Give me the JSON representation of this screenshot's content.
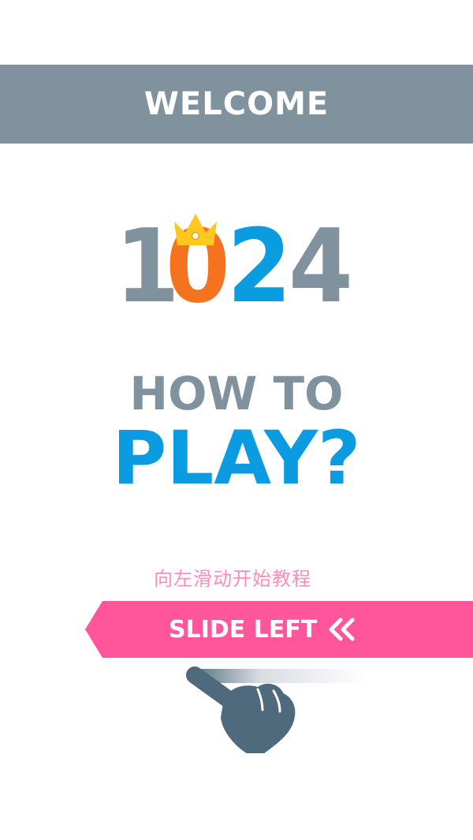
{
  "header": {
    "title": "WELCOME"
  },
  "logo": {
    "digits": [
      "1",
      "0",
      "2",
      "4"
    ],
    "colors": {
      "digit_1": "#7f929d",
      "digit_0": "#f5721f",
      "digit_2": "#0a9be0",
      "digit_4": "#7f929d",
      "crown": "#ffc81e"
    },
    "crown_icon": "crown-icon"
  },
  "tutorial": {
    "line1": "HOW TO",
    "line2": "PLAY?",
    "hint": "向左滑动开始教程"
  },
  "slide": {
    "label": "SLIDE LEFT",
    "arrows_icon": "double-chevron-left-icon",
    "color": "#ff559b"
  },
  "gesture": {
    "icon": "pointing-hand-icon",
    "color": "#4f6a7d"
  },
  "theme": {
    "header_bg": "#7f929d",
    "title_gray": "#7f929d",
    "title_blue": "#0a9be0",
    "hint_pink": "#ff8cba"
  }
}
